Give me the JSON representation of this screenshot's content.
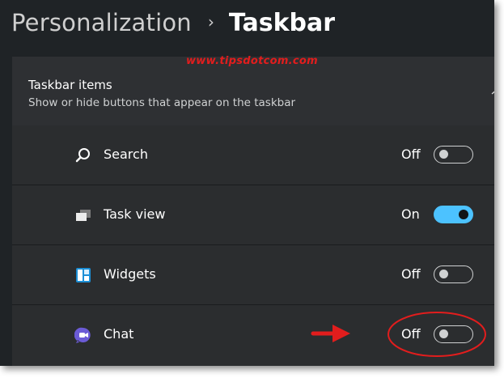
{
  "breadcrumb": {
    "parent": "Personalization",
    "separator": "›",
    "current": "Taskbar"
  },
  "watermark": "www.tipsdotcom.com",
  "section": {
    "title": "Taskbar items",
    "subtitle": "Show or hide buttons that appear on the taskbar",
    "expanded": true
  },
  "items": [
    {
      "label": "Search",
      "state": "Off",
      "on": false,
      "icon": "search-icon"
    },
    {
      "label": "Task view",
      "state": "On",
      "on": true,
      "icon": "task-view-icon"
    },
    {
      "label": "Widgets",
      "state": "Off",
      "on": false,
      "icon": "widgets-icon"
    },
    {
      "label": "Chat",
      "state": "Off",
      "on": false,
      "icon": "chat-icon"
    }
  ],
  "colors": {
    "accent": "#4cc2ff",
    "annotation": "#e21d1d"
  }
}
